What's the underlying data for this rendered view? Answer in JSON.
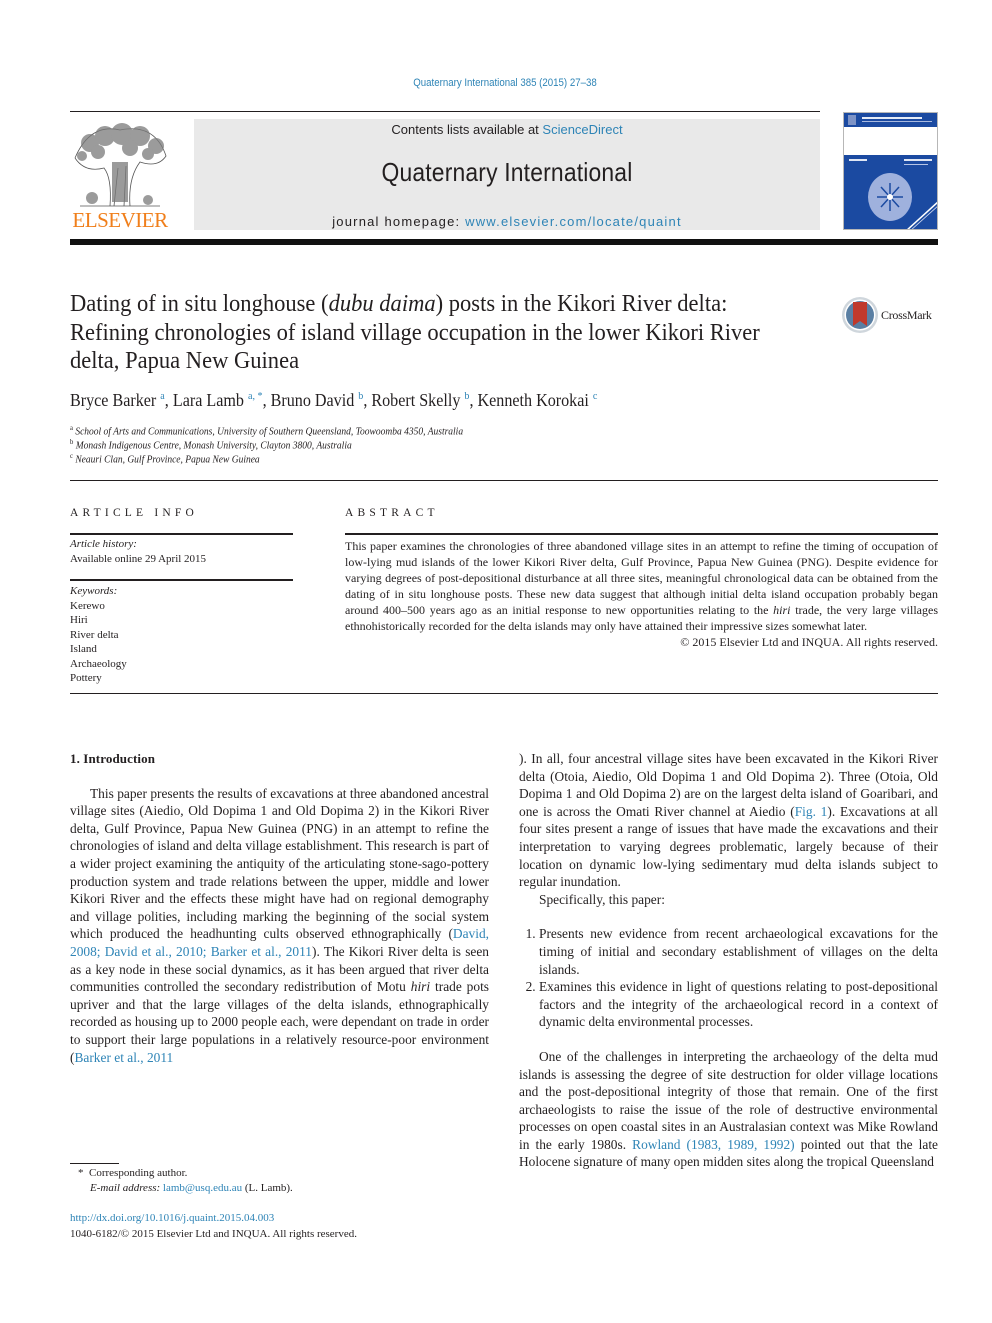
{
  "header": {
    "journal_ref": "Quaternary International 385 (2015) 27–38",
    "contents_prefix": "Contents lists available at ",
    "contents_link": "ScienceDirect",
    "journal_name": "Quaternary International",
    "homepage_prefix": "journal homepage: ",
    "homepage_link": "www.elsevier.com/locate/quaint",
    "publisher_logo": "ELSEVIER",
    "crossmark_label": "CrossMark"
  },
  "article": {
    "title_part1": "Dating of in situ longhouse (",
    "title_italic": "dubu daima",
    "title_part2": ") posts in the Kikori River delta: Refining chronologies of island village occupation in the lower Kikori River delta, Papua New Guinea",
    "authors": [
      {
        "name": "Bryce Barker",
        "sup": "a"
      },
      {
        "name": "Lara Lamb",
        "sup": "a, *"
      },
      {
        "name": "Bruno David",
        "sup": "b"
      },
      {
        "name": "Robert Skelly",
        "sup": "b"
      },
      {
        "name": "Kenneth Korokai",
        "sup": "c"
      }
    ],
    "affiliations": [
      {
        "key": "a",
        "text": "School of Arts and Communications, University of Southern Queensland, Toowoomba 4350, Australia"
      },
      {
        "key": "b",
        "text": "Monash Indigenous Centre, Monash University, Clayton 3800, Australia"
      },
      {
        "key": "c",
        "text": "Neauri Clan, Gulf Province, Papua New Guinea"
      }
    ]
  },
  "article_info": {
    "heading": "ARTICLE INFO",
    "history_label": "Article history:",
    "history_value": "Available online 29 April 2015",
    "keywords_label": "Keywords:",
    "keywords": [
      "Kerewo",
      "Hiri",
      "River delta",
      "Island",
      "Archaeology",
      "Pottery"
    ]
  },
  "abstract": {
    "heading": "ABSTRACT",
    "text_part1": "This paper examines the chronologies of three abandoned village sites in an attempt to refine the timing of occupation of low-lying mud islands of the lower Kikori River delta, Gulf Province, Papua New Guinea (PNG). Despite evidence for varying degrees of post-depositional disturbance at all three sites, meaningful chronological data can be obtained from the dating of in situ longhouse posts. These new data suggest that although initial delta island occupation probably began around 400–500 years ago as an initial response to new opportunities relating to the ",
    "text_italic": "hiri",
    "text_part2": " trade, the very large villages ethnohistorically recorded for the delta islands may only have attained their impressive sizes somewhat later.",
    "copyright": "© 2015 Elsevier Ltd and INQUA. All rights reserved."
  },
  "body": {
    "intro_heading": "1.  Introduction",
    "p1_a": "This paper presents the results of excavations at three abandoned ancestral village sites (Aiedio, Old Dopima 1 and Old Dopima 2) in the Kikori River delta, Gulf Province, Papua New Guinea (PNG) in an attempt to refine the chronologies of island and delta village establishment. This research is part of a wider project examining the antiquity of the articulating stone-sago-pottery production system and trade relations between the upper, middle and lower Kikori River and the effects these might have had on regional demography and village polities, including marking the beginning of the social system which produced the headhunting cults observed ethnographically (",
    "p1_link1": "David, 2008; David et al., 2010; Barker et al., 2011",
    "p1_b": "). The Kikori River delta is seen as a key node in these social dynamics, as it has been argued that river delta communities controlled the secondary redistribution of Motu ",
    "p1_italic": "hiri",
    "p1_c": " trade pots upriver and that the large villages of the delta islands, ethnographically recorded as housing up to 2000 people each, were dependant on trade in order to support their large populations in a relatively resource-poor environment (",
    "p1_link2": "Barker et al., 2011",
    "p1_d": "). In all, four ancestral village sites have been excavated in the Kikori River delta (Otoia, Aiedio, Old Dopima 1 and Old Dopima 2). Three (Otoia, Old Dopima 1 and Old Dopima 2) are on the largest delta island of Goaribari, and one is across the Omati River channel at Aiedio (",
    "p1_link3": "Fig. 1",
    "p1_e": "). Excavations at all four sites present a range of issues that have made the excavations and their interpretation to varying degrees problematic, largely because of their location on dynamic low-lying sedimentary mud delta islands subject to regular inundation.",
    "p2": "Specifically, this paper:",
    "list": [
      "Presents new evidence from recent archaeological excavations for the timing of initial and secondary establishment of villages on the delta islands.",
      "Examines this evidence in light of questions relating to post-depositional factors and the integrity of the archaeological record in a context of dynamic delta environmental processes."
    ],
    "p3_a": "One of the challenges in interpreting the archaeology of the delta mud islands is assessing the degree of site destruction for older village locations and the post-depositional integrity of those that remain. One of the first archaeologists to raise the issue of the role of destructive environmental processes on open coastal sites in an Australasian context was Mike Rowland in the early 1980s. ",
    "p3_link": "Rowland (1983, 1989, 1992)",
    "p3_b": " pointed out that the late Holocene signature of many open midden sites along the tropical Queensland"
  },
  "footnotes": {
    "corresponding_mark": "*",
    "corresponding_text": "Corresponding author.",
    "email_label": "E-mail address:",
    "email": "lamb@usq.edu.au",
    "email_suffix": " (L. Lamb).",
    "doi": "http://dx.doi.org/10.1016/j.quaint.2015.04.003",
    "issn_line": "1040-6182/© 2015 Elsevier Ltd and INQUA. All rights reserved."
  },
  "colors": {
    "link": "#2e84b6",
    "elsevier_orange": "#f07f1b",
    "banner_bg": "#e9e9e9",
    "cover_blue": "#1b4aa1"
  }
}
